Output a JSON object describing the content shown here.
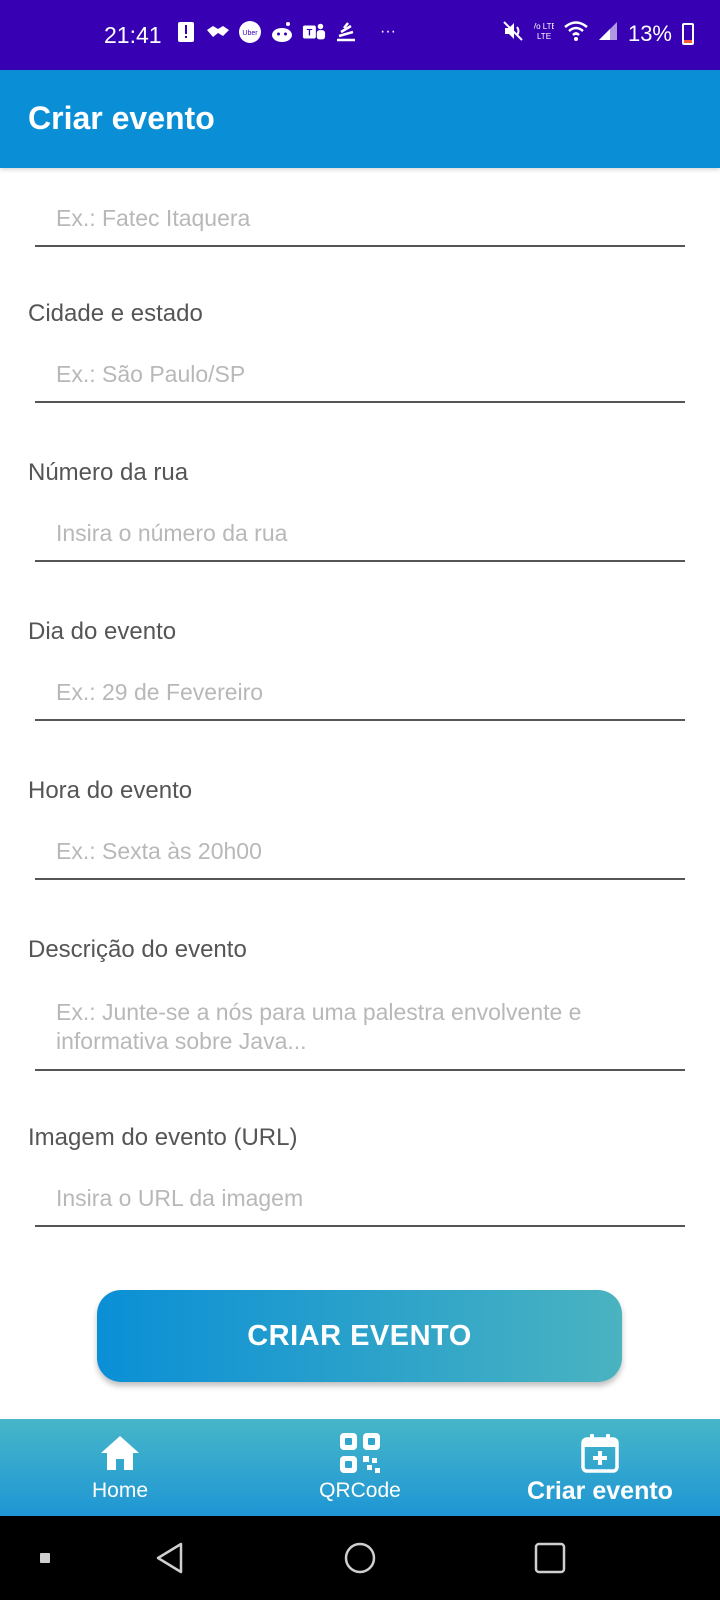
{
  "status_bar": {
    "time": "21:41",
    "battery_percent": "13%",
    "battery_level": 0.13,
    "overflow": "···",
    "volte_label": "Vo LTE",
    "notification_icons": [
      "alert-icon",
      "handshake-icon",
      "uber-icon",
      "reddit-icon",
      "teams-icon",
      "stacks-icon"
    ],
    "colors": {
      "background": "#3700b3",
      "battery_low": "#ff5a3c"
    }
  },
  "app_bar": {
    "title": "Criar evento",
    "color": "#0a8fd6"
  },
  "form": {
    "location_name": {
      "placeholder": "Ex.: Fatec Itaquera"
    },
    "city_state": {
      "label": "Cidade e estado",
      "placeholder": "Ex.: São Paulo/SP"
    },
    "street_number": {
      "label": "Número da rua",
      "placeholder": "Insira o número da rua"
    },
    "event_date": {
      "label": "Dia do evento",
      "placeholder": "Ex.: 29 de Fevereiro"
    },
    "event_time": {
      "label": "Hora do evento",
      "placeholder": "Ex.: Sexta às 20h00"
    },
    "description": {
      "label": "Descrição do evento",
      "placeholder_line1": "Ex.: Junte-se a nós para uma palestra envolvente e",
      "placeholder_line2": "informativa sobre Java..."
    },
    "image_url": {
      "label": "Imagem do evento (URL)",
      "placeholder": "Insira o URL da imagem"
    }
  },
  "create_button": {
    "label": "CRIAR EVENTO"
  },
  "bottom_nav": {
    "items": [
      {
        "label": "Home",
        "icon": "home-icon"
      },
      {
        "label": "QRCode",
        "icon": "qrcode-icon"
      },
      {
        "label": "Criar evento",
        "icon": "calendar-add-icon",
        "active": true
      }
    ]
  },
  "system_nav": {
    "buttons": [
      "recents-dot",
      "back",
      "home",
      "overview"
    ]
  }
}
